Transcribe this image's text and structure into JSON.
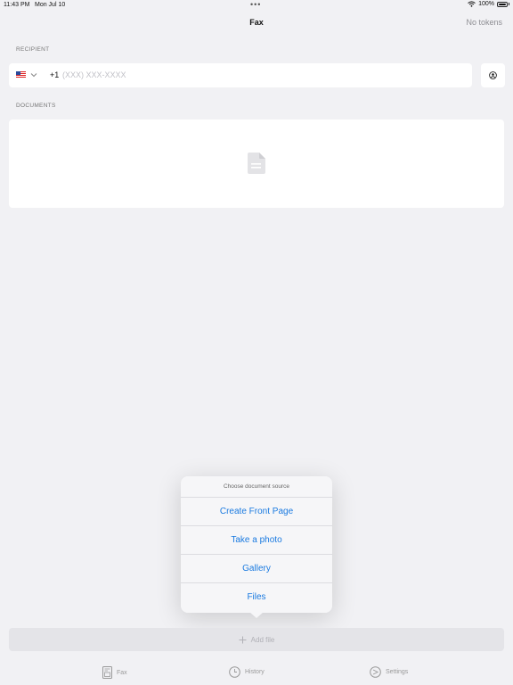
{
  "status_bar": {
    "time": "11:43 PM",
    "date": "Mon Jul 10",
    "battery": "100%"
  },
  "nav": {
    "title": "Fax",
    "right_label": "No tokens"
  },
  "recipient": {
    "section_label": "RECIPIENT",
    "country_flag": "us-flag-icon",
    "dial_code": "+1",
    "phone_value": "",
    "phone_placeholder": "(XXX) XXX-XXXX"
  },
  "documents": {
    "section_label": "DOCUMENTS"
  },
  "popover": {
    "title": "Choose document source",
    "items": [
      {
        "label": "Create Front Page"
      },
      {
        "label": "Take a photo"
      },
      {
        "label": "Gallery"
      },
      {
        "label": "Files"
      }
    ]
  },
  "add_file": {
    "label": "Add file"
  },
  "tabs": [
    {
      "label": "Fax",
      "icon": "fax-icon"
    },
    {
      "label": "History",
      "icon": "clock-icon"
    },
    {
      "label": "Settings",
      "icon": "settings-icon"
    }
  ],
  "colors": {
    "accent": "#1a7ae0",
    "background": "#f1f1f4",
    "placeholder": "#c0c0c6",
    "inactive": "#999999"
  }
}
